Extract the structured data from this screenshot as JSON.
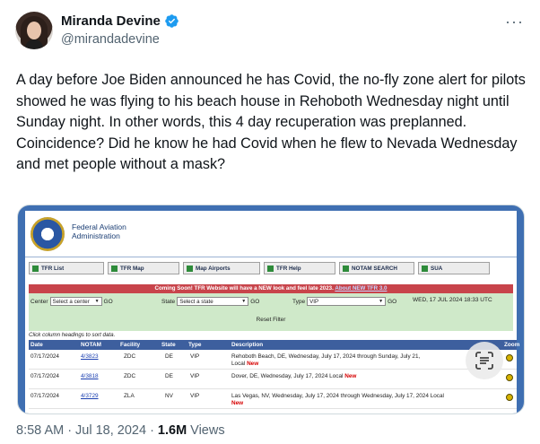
{
  "author": {
    "name": "Miranda Devine",
    "handle": "@mirandadevine",
    "verified": true
  },
  "more_label": "···",
  "tweet": {
    "paragraph1": "A day before Joe Biden announced he has Covid, the no-fly zone alert for pilots showed he was flying to his beach house in Rehoboth Wednesday night until Sunday night. In other words, this 4 day recuperation was preplanned.",
    "paragraph2": "Coincidence? Did he know he had Covid when he flew to Nevada Wednesday and met people without a mask?"
  },
  "media": {
    "faa_title_line1": "Federal Aviation",
    "faa_title_line2": "Administration",
    "nav": [
      "TFR List",
      "TFR Map",
      "Map Airports",
      "TFR Help",
      "NOTAM SEARCH",
      "SUA"
    ],
    "banner_text": "Coming Soon! TFR Website will have a NEW look and feel late 2023.",
    "banner_link": "About NEW TFR 3.0",
    "filters": {
      "center_label": "Center",
      "center_value": "Select a center",
      "state_label": "State",
      "state_value": "Select a state",
      "type_label": "Type",
      "type_value": "VIP",
      "go_label": "GO",
      "timestamp": "WED, 17 JUL 2024 18:33 UTC",
      "reset_label": "Reset Filter"
    },
    "hint": "Click column headings to sort data.",
    "columns": [
      "Date",
      "NOTAM",
      "Facility",
      "State",
      "Type",
      "Description",
      "Zoom"
    ],
    "rows": [
      {
        "date": "07/17/2024",
        "notam": "4/3823",
        "facility": "ZDC",
        "state": "DE",
        "type": "VIP",
        "desc_line1": "Rehoboth Beach, DE, Wednesday, July 17, 2024 through Sunday, July 21,",
        "desc_line2": "Local",
        "new": "New"
      },
      {
        "date": "07/17/2024",
        "notam": "4/3818",
        "facility": "ZDC",
        "state": "DE",
        "type": "VIP",
        "desc_line1": "Dover, DE, Wednesday, July 17, 2024 Local",
        "desc_line2": "",
        "new": "New"
      },
      {
        "date": "07/17/2024",
        "notam": "4/3729",
        "facility": "ZLA",
        "state": "NV",
        "type": "VIP",
        "desc_line1": "Las Vegas, NV, Wednesday, July 17, 2024 through Wednesday, July 17, 2024 Local",
        "desc_line2": "",
        "new": "New"
      }
    ]
  },
  "footer": {
    "time": "8:58 AM",
    "sep1": "·",
    "date": "Jul 18, 2024",
    "sep2": "·",
    "views_count": "1.6M",
    "views_label": "Views"
  },
  "colors": {
    "verified_badge": "#1d9bf0",
    "secondary_text": "#536471",
    "banner_red": "#c8444b",
    "filter_green": "#cfe9c9",
    "table_header_blue": "#3d5f9e"
  }
}
